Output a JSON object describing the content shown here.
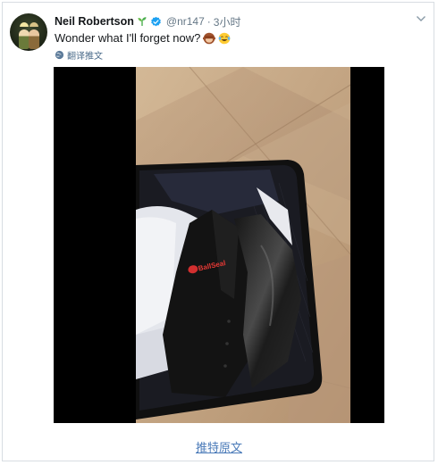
{
  "tweet": {
    "author_name": "Neil Robertson",
    "handle": "@nr147",
    "separator": "·",
    "time": "3小时",
    "text": "Wonder what I'll forget now?",
    "translate_label": "翻译推文"
  },
  "vest_brand": "BallSeal",
  "footer": {
    "link_label": "推特原文"
  },
  "colors": {
    "link": "#4a7ab8",
    "verified": "#1da1f2",
    "muted": "#657786"
  },
  "icons": [
    "sprout-icon",
    "verified-icon",
    "chevron-down-icon",
    "see-no-evil-monkey-emoji",
    "laughing-tears-emoji",
    "globe-icon"
  ]
}
